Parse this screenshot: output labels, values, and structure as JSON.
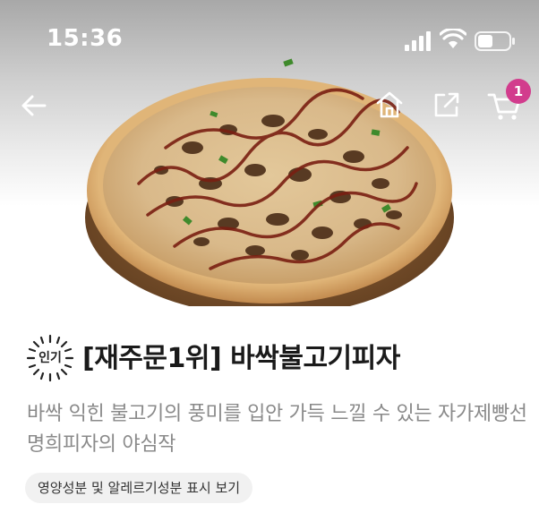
{
  "status_bar": {
    "time": "15:36"
  },
  "header": {
    "cart_count": "1"
  },
  "product": {
    "badge": "인기",
    "title": "[재주문1위] 바싹불고기피자",
    "description": "바싹 익힌 불고기의 풍미를 입안 가득 느낄 수 있는 자가제빵선명희피자의 야심작",
    "nutrition_button": "영양성분 및 알레르기성분 표시 보기"
  },
  "colors": {
    "badge_accent": "#d23c8d",
    "description_text": "#8a8a8a"
  },
  "icons": [
    "back-arrow-icon",
    "home-icon",
    "share-icon",
    "cart-icon",
    "signal-icon",
    "wifi-icon",
    "battery-icon"
  ]
}
